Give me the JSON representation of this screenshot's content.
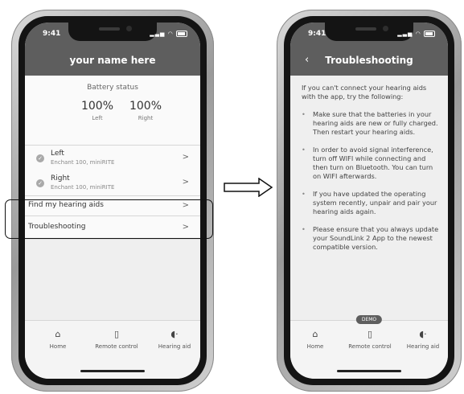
{
  "left_phone": {
    "status_time": "9:41",
    "header_title": "your name here",
    "battery": {
      "title": "Battery status",
      "left_value": "100%",
      "left_label": "Left",
      "right_value": "100%",
      "right_label": "Right"
    },
    "devices": [
      {
        "title": "Left",
        "subtitle": "Enchant 100, miniRITE"
      },
      {
        "title": "Right",
        "subtitle": "Enchant 100, miniRITE"
      }
    ],
    "menu": [
      {
        "label": "Find my hearing aids"
      },
      {
        "label": "Troubleshooting"
      }
    ],
    "tabs": [
      {
        "icon": "home-icon",
        "label": "Home"
      },
      {
        "icon": "remote-control-icon",
        "label": "Remote control"
      },
      {
        "icon": "hearing-aid-icon",
        "label": "Hearing aid"
      }
    ]
  },
  "right_phone": {
    "status_time": "9:41",
    "header_title": "Troubleshooting",
    "intro": "If you can't connect your hearing aids with the app, try the following:",
    "tips": [
      "Make sure that the batteries in your hearing aids are new or fully charged. Then restart your hearing aids.",
      "In order to avoid signal interference, turn off WIFI while connecting and then turn on Bluetooth. You can turn on WIFI afterwards.",
      "If you have updated the operating system recently, unpair and pair your hearing aids again.",
      "Please ensure that you always update your SoundLink 2 App to the newest compatible version."
    ],
    "demo_badge": "DEMO",
    "tabs": [
      {
        "icon": "home-icon",
        "label": "Home"
      },
      {
        "icon": "remote-control-icon",
        "label": "Remote control"
      },
      {
        "icon": "hearing-aid-icon",
        "label": "Hearing aid"
      }
    ]
  },
  "colors": {
    "header": "#5e5e5e",
    "screen_bg": "#efefef",
    "card_bg": "#fafafa"
  }
}
